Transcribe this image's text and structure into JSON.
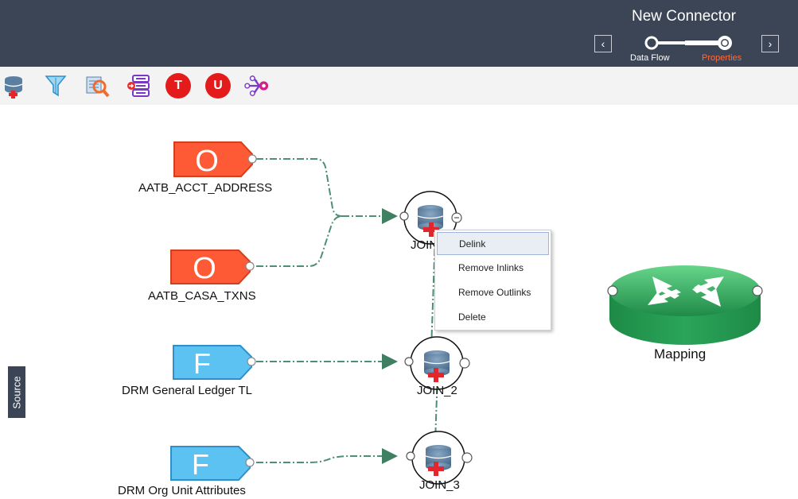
{
  "header": {
    "title": "New Connector",
    "steps": [
      {
        "label": "Data Flow",
        "color": "#ffffff"
      },
      {
        "label": "Properties",
        "color": "#ff6b3d"
      }
    ],
    "prev_icon": "chevron-left-icon",
    "next_icon": "chevron-right-icon"
  },
  "toolbar": {
    "tools": [
      {
        "name": "add-database-icon"
      },
      {
        "name": "filter-icon"
      },
      {
        "name": "lookup-icon"
      },
      {
        "name": "import-icon"
      },
      {
        "name": "t-icon",
        "text": "T"
      },
      {
        "name": "u-icon",
        "text": "U"
      },
      {
        "name": "split-icon"
      }
    ]
  },
  "nodes": {
    "acct_address": {
      "glyph": "O",
      "label": "AATB_ACCT_ADDRESS"
    },
    "casa_txns": {
      "glyph": "O",
      "label": "AATB_CASA_TXNS"
    },
    "gl": {
      "glyph": "F",
      "label": "DRM General Ledger TL"
    },
    "org_unit": {
      "glyph": "F",
      "label": "DRM Org Unit Attributes"
    },
    "join1": {
      "label": "JOIN_1"
    },
    "join2": {
      "label": "JOIN_2"
    },
    "join3": {
      "label": "JOIN_3"
    },
    "mapping": {
      "label": "Mapping"
    }
  },
  "context_menu": {
    "items": [
      "Delink",
      "Remove Inlinks",
      "Remove Outlinks",
      "Delete"
    ]
  },
  "side_tab": {
    "label": "Source"
  },
  "colors": {
    "header": "#3b4556",
    "source_orange": "#ff5a36",
    "source_blue": "#5bc2f2",
    "link": "#4d8f71",
    "mapping_green": "#28a85a"
  }
}
